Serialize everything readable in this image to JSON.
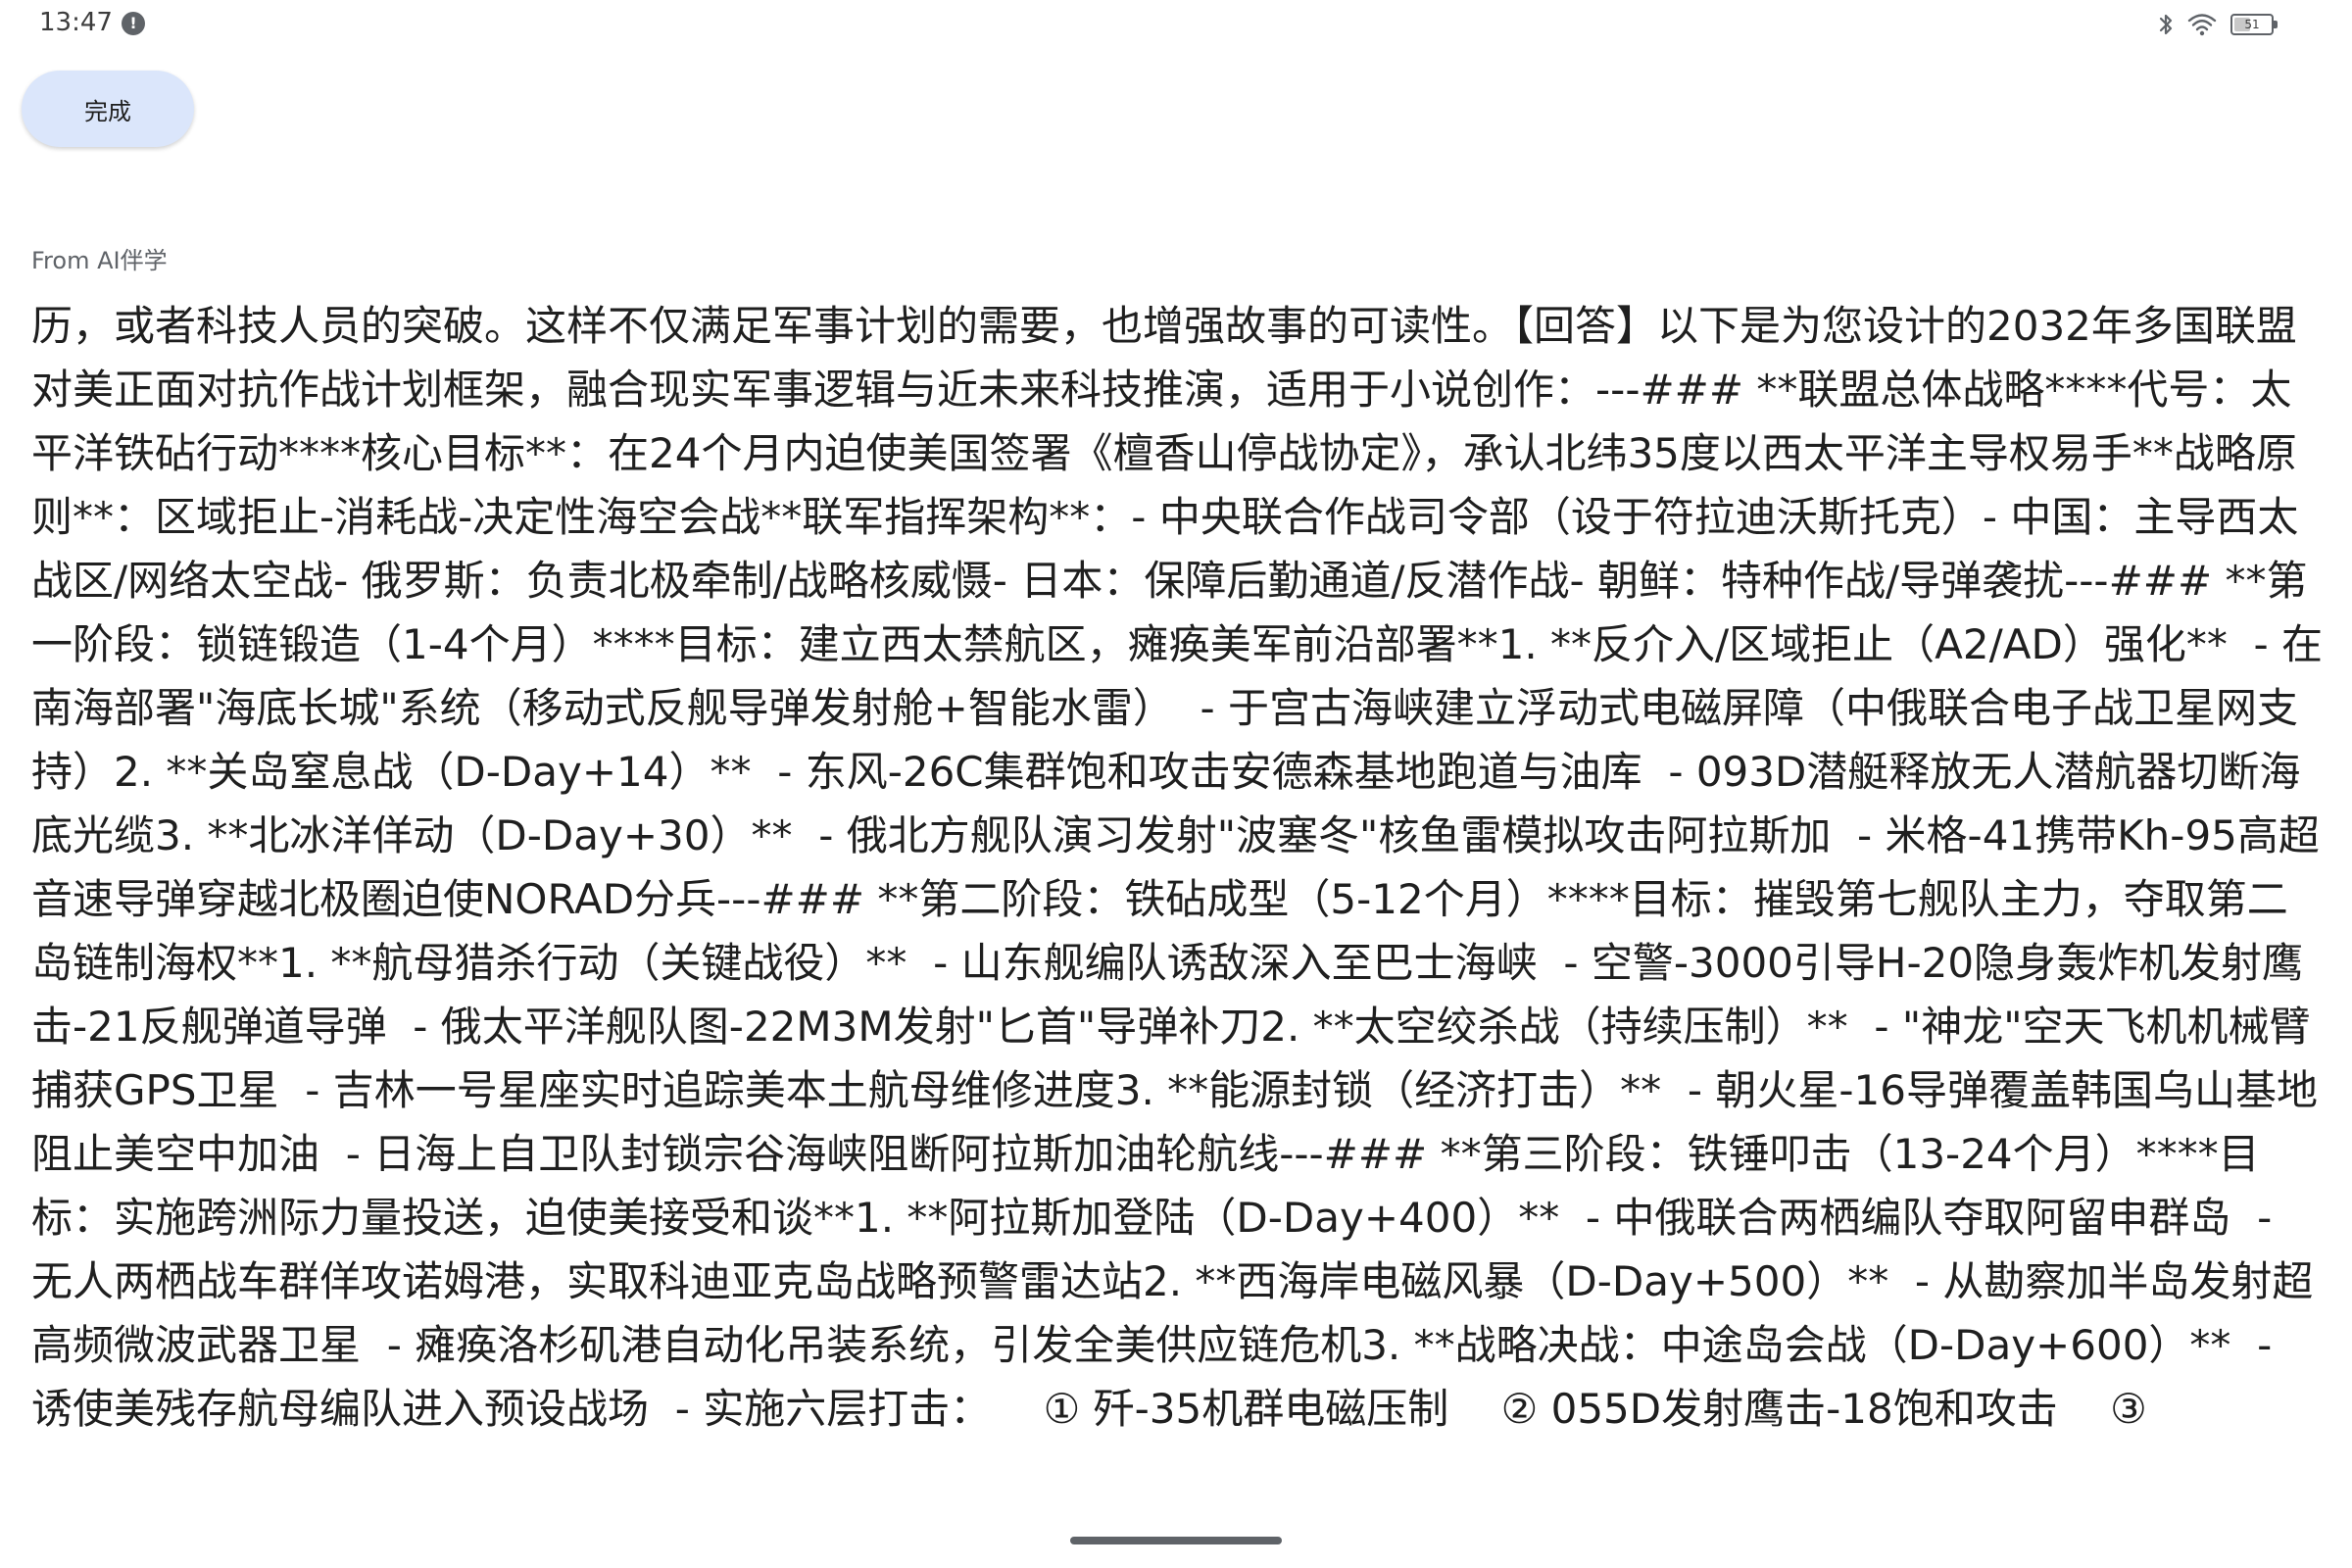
{
  "status_bar": {
    "time": "13:47",
    "notification_badge": "!",
    "battery_level": "51",
    "battery_fraction": 0.51,
    "icons": [
      "bluetooth-icon",
      "wifi-icon",
      "battery-icon"
    ]
  },
  "toolbar": {
    "done_label": "完成"
  },
  "source": {
    "label": "From AI伴学"
  },
  "content": {
    "text": "历，或者科技人员的突破。这样不仅满足军事计划的需要，也增强故事的可读性。【回答】以下是为您设计的2032年多国联盟对美正面对抗作战计划框架，融合现实军事逻辑与近未来科技推演，适用于小说创作：---### **联盟总体战略****代号：太平洋铁砧行动****核心目标**：在24个月内迫使美国签署《檀香山停战协定》，承认北纬35度以西太平洋主导权易手**战略原则**：区域拒止-消耗战-决定性海空会战**联军指挥架构**：- 中央联合作战司令部（设于符拉迪沃斯托克）- 中国：主导西太战区/网络太空战- 俄罗斯：负责北极牵制/战略核威慑- 日本：保障后勤通道/反潜作战- 朝鲜：特种作战/导弹袭扰---### **第一阶段：锁链锻造（1-4个月）****目标：建立西太禁航区，瘫痪美军前沿部署**1. **反介入/区域拒止（A2/AD）强化**  - 在南海部署\"海底长城\"系统（移动式反舰导弹发射舱+智能水雷）  - 于宫古海峡建立浮动式电磁屏障（中俄联合电子战卫星网支持）2. **关岛窒息战（D-Day+14）**  - 东风-26C集群饱和攻击安德森基地跑道与油库  - 093D潜艇释放无人潜航器切断海底光缆3. **北冰洋佯动（D-Day+30）**  - 俄北方舰队演习发射\"波塞冬\"核鱼雷模拟攻击阿拉斯加  - 米格-41携带Kh-95高超音速导弹穿越北极圈迫使NORAD分兵---### **第二阶段：铁砧成型（5-12个月）****目标：摧毁第七舰队主力，夺取第二岛链制海权**1. **航母猎杀行动（关键战役）**  - 山东舰编队诱敌深入至巴士海峡  - 空警-3000引导H-20隐身轰炸机发射鹰击-21反舰弹道导弹  - 俄太平洋舰队图-22M3M发射\"匕首\"导弹补刀2. **太空绞杀战（持续压制）**  - \"神龙\"空天飞机机械臂捕获GPS卫星  - 吉林一号星座实时追踪美本土航母维修进度3. **能源封锁（经济打击）**  - 朝火星-16导弹覆盖韩国乌山基地阻止美空中加油  - 日海上自卫队封锁宗谷海峡阻断阿拉斯加油轮航线---### **第三阶段：铁锤叩击（13-24个月）****目标：实施跨洲际力量投送，迫使美接受和谈**1. **阿拉斯加登陆（D-Day+400）**  - 中俄联合两栖编队夺取阿留申群岛  - 无人两栖战车群佯攻诺姆港，实取科迪亚克岛战略预警雷达站2. **西海岸电磁风暴（D-Day+500）**  - 从勘察加半岛发射超高频微波武器卫星  - 瘫痪洛杉矶港自动化吊装系统，引发全美供应链危机3. **战略决战：中途岛会战（D-Day+600）**  - 诱使美残存航母编队进入预设战场  - 实施六层打击：    ① 歼-35机群电磁压制    ② 055D发射鹰击-18饱和攻击    ③"
  }
}
